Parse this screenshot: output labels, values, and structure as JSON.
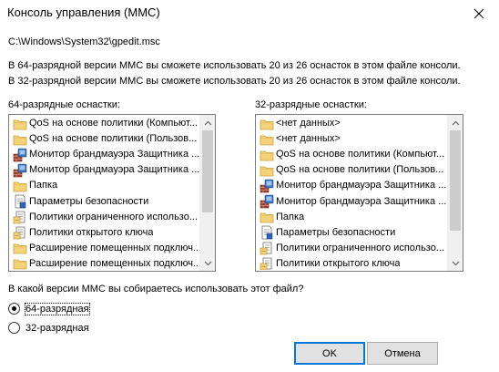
{
  "window": {
    "title": "Консоль управления (MMC)"
  },
  "dialog": {
    "file_path": "C:\\Windows\\System32\\gpedit.msc",
    "info_64": "В 64-разрядной версии MMC вы сможете использовать 20 из 26 оснасток в этом файле консоли.",
    "info_32": "В 32-разрядной версии MMC вы сможете использовать 20 из 26 оснасток в этом файле консоли.",
    "left_list": {
      "label": "64-разрядные оснастки:",
      "items": [
        {
          "label": "QoS на основе политики (Компьют...",
          "icon": "folder-icon"
        },
        {
          "label": "QoS на основе политики (Пользов...",
          "icon": "folder-icon"
        },
        {
          "label": "Монитор брандмауэра Защитника ...",
          "icon": "firewall-icon"
        },
        {
          "label": "Монитор брандмауэра Защитника ...",
          "icon": "firewall-icon"
        },
        {
          "label": "Папка",
          "icon": "folder-icon"
        },
        {
          "label": "Параметры безопасности",
          "icon": "security-doc-icon"
        },
        {
          "label": "Политики ограниченного использо...",
          "icon": "policy-icon"
        },
        {
          "label": "Политики открытого ключа",
          "icon": "policy-icon"
        },
        {
          "label": "Расширение помещенных подключ...",
          "icon": "folder-icon"
        },
        {
          "label": "Расширение помещенных подключ...",
          "icon": "folder-icon"
        }
      ]
    },
    "right_list": {
      "label": "32-разрядные оснастки:",
      "items": [
        {
          "label": "<нет данных>",
          "icon": "folder-icon"
        },
        {
          "label": "<нет данных>",
          "icon": "folder-icon"
        },
        {
          "label": "QoS на основе политики (Компьют...",
          "icon": "folder-icon"
        },
        {
          "label": "QoS на основе политики (Пользов...",
          "icon": "folder-icon"
        },
        {
          "label": "Монитор брандмауэра Защитника ...",
          "icon": "firewall-icon"
        },
        {
          "label": "Монитор брандмауэра Защитника ...",
          "icon": "firewall-icon"
        },
        {
          "label": "Папка",
          "icon": "folder-icon"
        },
        {
          "label": "Параметры безопасности",
          "icon": "security-doc-icon"
        },
        {
          "label": "Политики ограниченного использо...",
          "icon": "policy-icon"
        },
        {
          "label": "Политики открытого ключа",
          "icon": "policy-icon"
        }
      ]
    },
    "question": "В какой версии MMC вы собираетесь использовать этот файл?",
    "options": [
      {
        "label": "64-разрядная",
        "selected": true
      },
      {
        "label": "32-разрядная",
        "selected": false
      }
    ],
    "ok_label": "OK",
    "cancel_label": "Отмена"
  },
  "colors": {
    "accent": "#0078d7",
    "folder": "#f4d27a",
    "scroll_thumb": "#cdcdcd"
  }
}
